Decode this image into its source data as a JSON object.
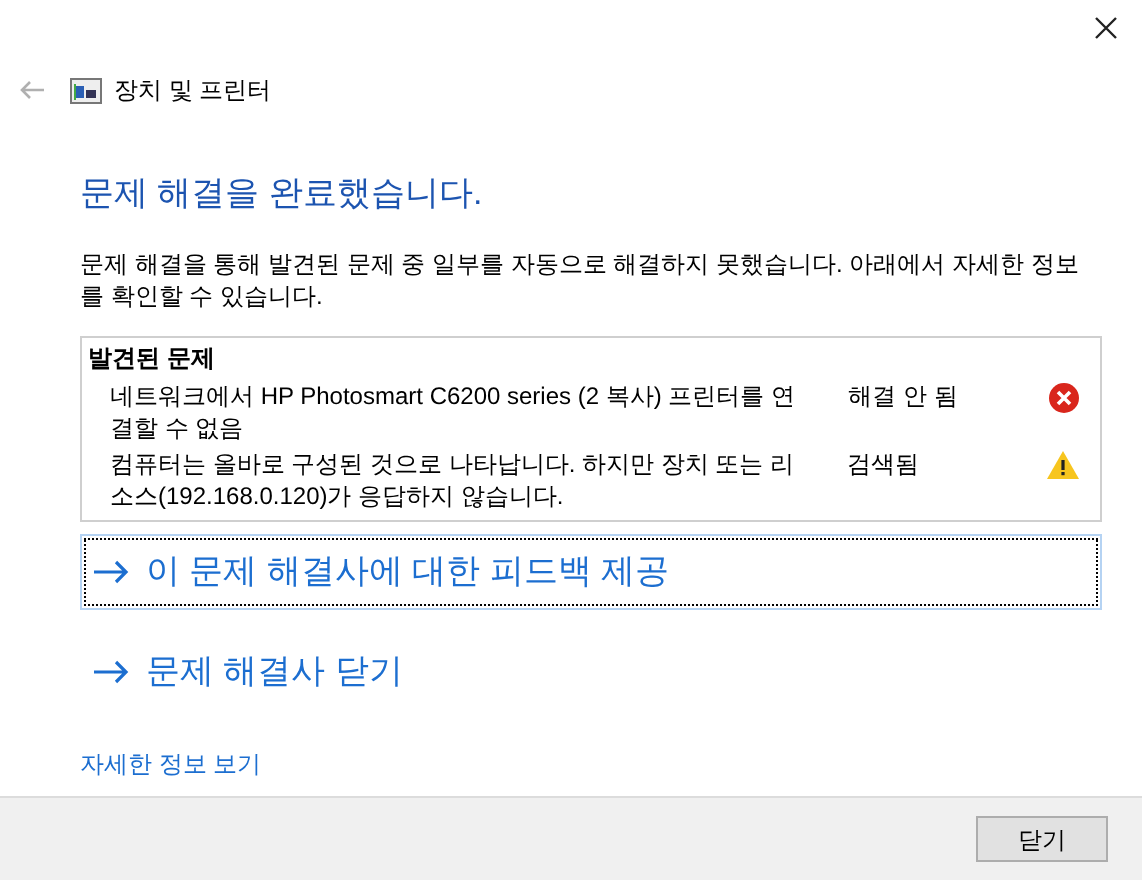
{
  "window": {
    "title": "장치 및 프린터"
  },
  "heading": "문제 해결을 완료했습니다.",
  "description": "문제 해결을 통해 발견된 문제 중 일부를 자동으로 해결하지 못했습니다. 아래에서 자세한 정보를 확인할 수 있습니다.",
  "problems": {
    "title": "발견된 문제",
    "items": [
      {
        "text": "네트워크에서 HP Photosmart C6200 series (2 복사) 프린터를 연결할 수 없음",
        "status": "해결 안 됨",
        "kind": "error"
      },
      {
        "text": "컴퓨터는 올바로 구성된 것으로 나타납니다. 하지만 장치 또는 리소스(192.168.0.120)가 응답하지 않습니다.",
        "status": "검색됨",
        "kind": "warning"
      }
    ]
  },
  "actions": [
    {
      "label": "이 문제 해결사에 대한 피드백 제공",
      "focused": true
    },
    {
      "label": "문제 해결사 닫기",
      "focused": false
    }
  ],
  "details_link": "자세한 정보 보기",
  "buttons": [
    "닫기"
  ]
}
